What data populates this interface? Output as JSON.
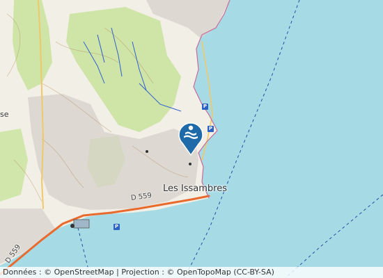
{
  "map": {
    "place_label": "Les Issambres",
    "roads": [
      "D 559",
      "D 559"
    ],
    "edge_label": "se",
    "marker": {
      "name": "beach-swimmer-marker",
      "color": "#1f6aa8"
    },
    "parking_glyph": "P",
    "colors": {
      "sea": "#a6dbe6",
      "land": "#f2efe6",
      "forest": "#c8e39b",
      "coast": "#e96a2d"
    }
  },
  "attribution": {
    "prefix": "Données : ©",
    "osm": "OpenStreetMap",
    "sep": "| Projection : ©",
    "otm": "OpenTopoMap",
    "license": "(CC-BY-SA)"
  }
}
